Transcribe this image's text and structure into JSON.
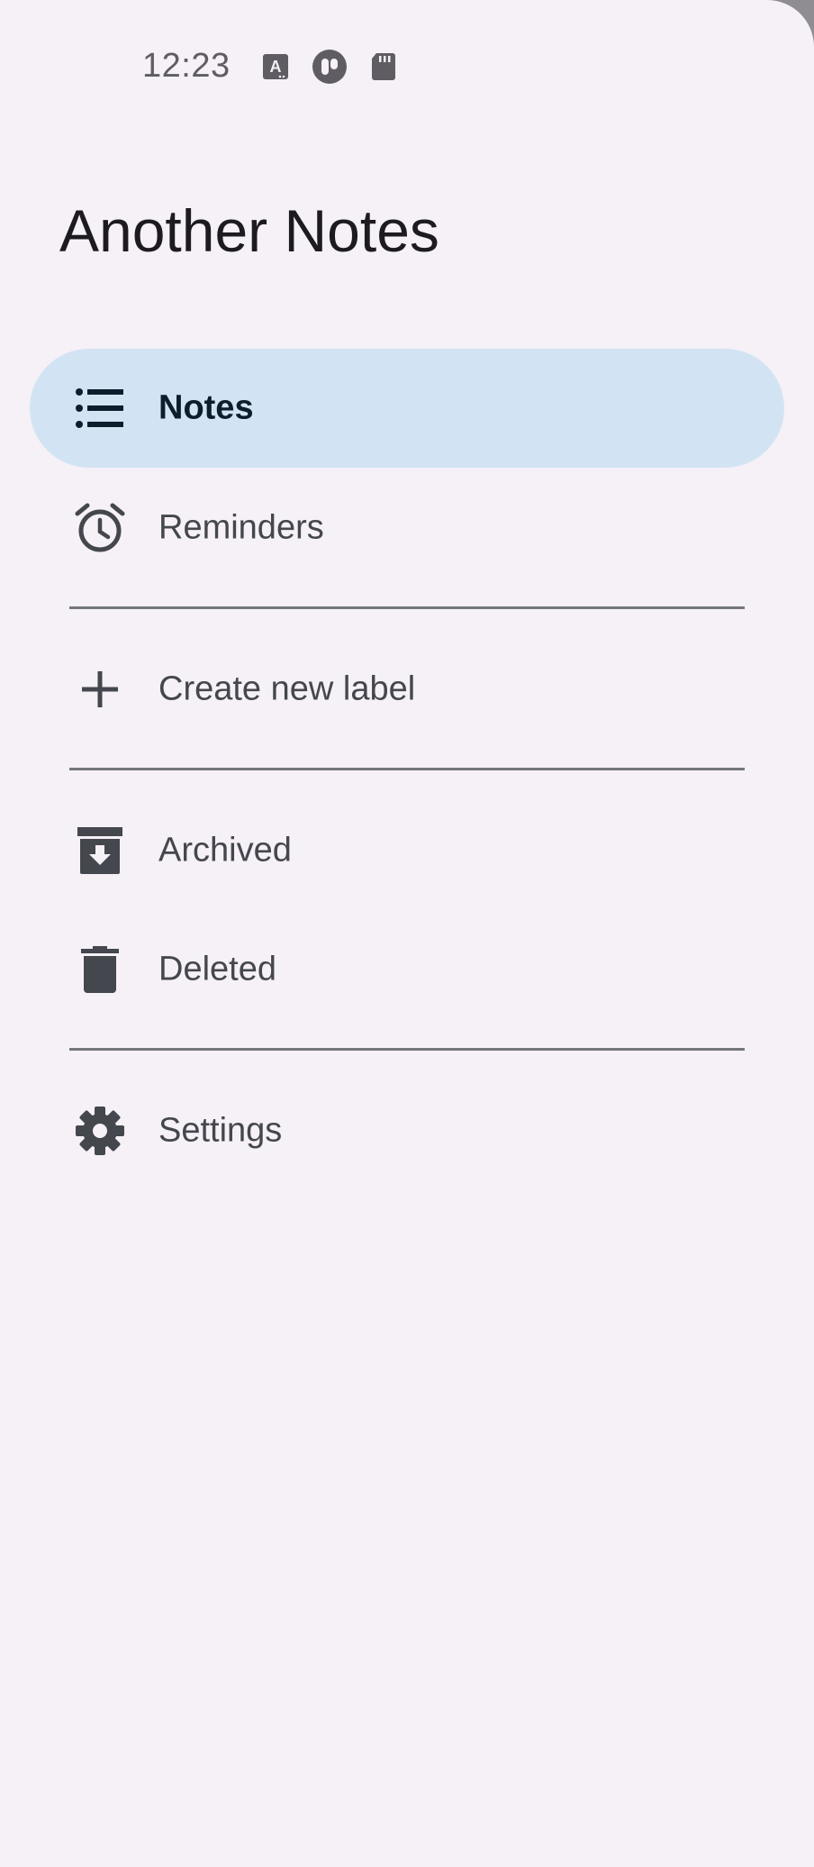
{
  "status_bar": {
    "time": "12:23",
    "icons": [
      "font-a-icon",
      "record-icon",
      "sd-card-icon"
    ]
  },
  "drawer": {
    "title": "Another Notes",
    "items": [
      {
        "label": "Notes",
        "icon": "list-icon",
        "active": true
      },
      {
        "label": "Reminders",
        "icon": "alarm-icon",
        "active": false
      },
      {
        "label": "Create new label",
        "icon": "plus-icon",
        "active": false
      },
      {
        "label": "Archived",
        "icon": "archive-icon",
        "active": false
      },
      {
        "label": "Deleted",
        "icon": "trash-icon",
        "active": false
      },
      {
        "label": "Settings",
        "icon": "gear-icon",
        "active": false
      }
    ]
  },
  "colors": {
    "drawer_bg": "#f6f0f7",
    "active_bg": "#d2e4f4",
    "icon": "#44474d",
    "active_text": "#0c1d2b"
  }
}
